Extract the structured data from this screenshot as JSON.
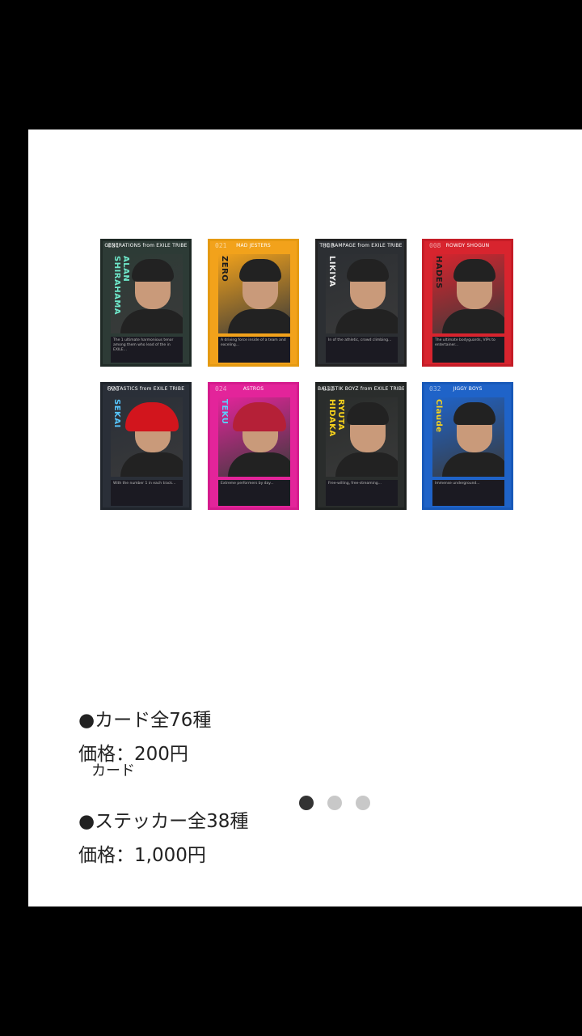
{
  "cards": [
    {
      "num": "021",
      "top": "GENERATIONS from EXILE TRIBE",
      "name": "ALAN\nSHIRAHAMA",
      "bg": "#2d3b36",
      "frame": "#1f2a26",
      "accent": "#6ee7c9",
      "hat": false,
      "desc": "The 1 ultimate harmonious tenor among them who lead of the in EXILE..."
    },
    {
      "num": "021",
      "top": "MAD JESTERS",
      "name": "ZERO",
      "bg": "#f2a21b",
      "frame": "#e59a12",
      "accent": "#1b1b1b",
      "hat": false,
      "desc": "A driving force inside of a team and exceling..."
    },
    {
      "num": "008",
      "top": "THE RAMPAGE from EXILE TRIBE",
      "name": "LIKIYA",
      "bg": "#2c2f33",
      "frame": "#222",
      "accent": "#e9e9e9",
      "hat": false,
      "desc": "In of the athletic, crowd climbing..."
    },
    {
      "num": "008",
      "top": "ROWDY SHOGUN",
      "name": "HADES",
      "bg": "#d8242e",
      "frame": "#c51d27",
      "accent": "#1b1b1b",
      "hat": false,
      "desc": "The ultimate bodyguards, VIPs to entertainer..."
    },
    {
      "num": "021",
      "top": "FANTASTICS from EXILE TRIBE",
      "name": "SEKAI",
      "bg": "#2a2f38",
      "frame": "#20252c",
      "accent": "#57c7ff",
      "hat": true,
      "hatColor": "#d2151d",
      "desc": "With the number 1 in each track..."
    },
    {
      "num": "024",
      "top": "ASTROS",
      "name": "TEKU",
      "bg": "#e3249a",
      "frame": "#d51b8d",
      "accent": "#5ad0ff",
      "hat": true,
      "hatColor": "#b52037",
      "desc": "Extreme performers by day..."
    },
    {
      "num": "032",
      "top": "BALLISTIK BOYZ from EXILE TRIBE",
      "name": "RYUTA\nHIDAKA",
      "bg": "#2a2d2c",
      "frame": "#1e2120",
      "accent": "#f7d21c",
      "hat": false,
      "desc": "Free-willing, free-streaming..."
    },
    {
      "num": "032",
      "top": "JIGGY BOYS",
      "name": "Claude",
      "bg": "#1f63c8",
      "frame": "#1859b9",
      "accent": "#f7d21c",
      "hat": false,
      "desc": "Immense underground..."
    }
  ],
  "caption": "カード",
  "carousel": {
    "total": 3,
    "active": 0
  },
  "info": {
    "card_line": "●カード全76種",
    "card_price": "価格：200円",
    "sticker_line": "●ステッカー全38種",
    "sticker_price": "価格：1,000円"
  }
}
